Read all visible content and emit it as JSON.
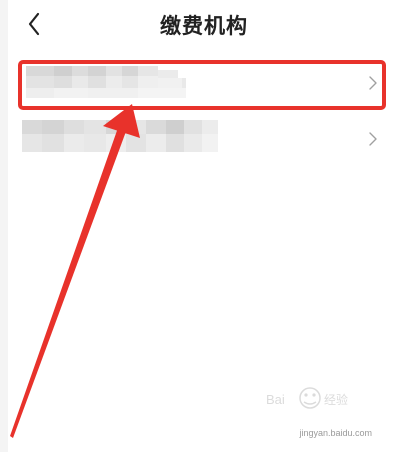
{
  "header": {
    "title": "缴费机构",
    "back_icon": "chevron-left-icon"
  },
  "list": {
    "items": [
      {
        "label": "",
        "chevron_icon": "chevron-right-icon"
      },
      {
        "label": "",
        "chevron_icon": "chevron-right-icon"
      }
    ]
  },
  "annotation": {
    "color": "#e8322b"
  },
  "watermark": {
    "text": "jingyan.baidu.com",
    "brand": "Baidu 经验"
  }
}
